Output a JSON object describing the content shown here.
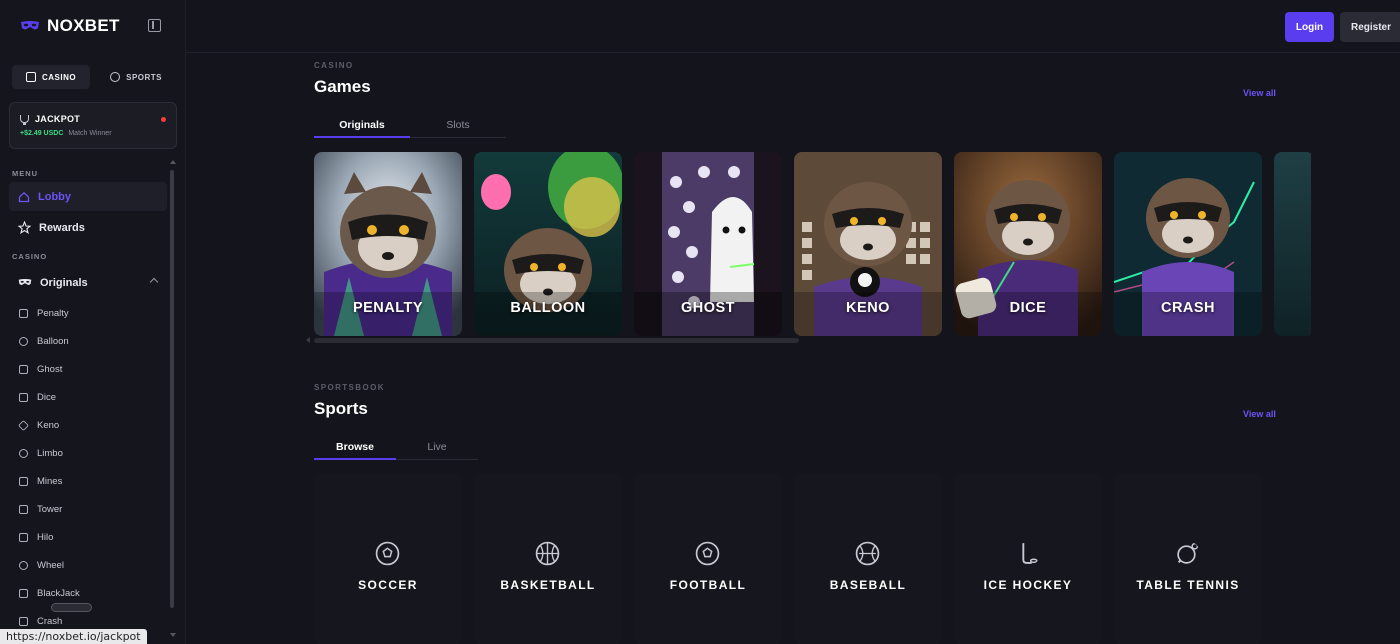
{
  "brand": {
    "name": "NOXBET"
  },
  "header": {
    "login_label": "Login",
    "register_label": "Register"
  },
  "sidebar": {
    "mode_tabs": [
      {
        "label": "CASINO"
      },
      {
        "label": "SPORTS"
      }
    ],
    "jackpot": {
      "title": "JACKPOT",
      "amount": "+$2.49 USDC",
      "subtitle": "Match Winner"
    },
    "menu_label": "MENU",
    "menu_items": [
      {
        "label": "Lobby"
      },
      {
        "label": "Rewards"
      }
    ],
    "casino_label": "CASINO",
    "originals_label": "Originals",
    "originals_items": [
      {
        "label": "Penalty"
      },
      {
        "label": "Balloon"
      },
      {
        "label": "Ghost"
      },
      {
        "label": "Dice"
      },
      {
        "label": "Keno"
      },
      {
        "label": "Limbo"
      },
      {
        "label": "Mines"
      },
      {
        "label": "Tower"
      },
      {
        "label": "Hilo"
      },
      {
        "label": "Wheel"
      },
      {
        "label": "BlackJack"
      },
      {
        "label": "Crash"
      }
    ]
  },
  "status_bar": {
    "url": "https://noxbet.io/jackpot"
  },
  "games_section": {
    "eyebrow": "CASINO",
    "title": "Games",
    "view_all": "View all",
    "tabs": [
      {
        "label": "Originals"
      },
      {
        "label": "Slots"
      }
    ],
    "cards": [
      {
        "title": "PENALTY"
      },
      {
        "title": "BALLOON"
      },
      {
        "title": "GHOST"
      },
      {
        "title": "KENO"
      },
      {
        "title": "DICE"
      },
      {
        "title": "CRASH"
      }
    ]
  },
  "sports_section": {
    "eyebrow": "SPORTSBOOK",
    "title": "Sports",
    "view_all": "View all",
    "tabs": [
      {
        "label": "Browse"
      },
      {
        "label": "Live"
      }
    ],
    "cards": [
      {
        "title": "SOCCER",
        "icon": "soccer-ball-icon"
      },
      {
        "title": "BASKETBALL",
        "icon": "basketball-icon"
      },
      {
        "title": "FOOTBALL",
        "icon": "football-icon"
      },
      {
        "title": "BASEBALL",
        "icon": "baseball-icon"
      },
      {
        "title": "ICE HOCKEY",
        "icon": "hockey-stick-icon"
      },
      {
        "title": "TABLE TENNIS",
        "icon": "table-tennis-icon"
      }
    ]
  },
  "colors": {
    "accent": "#5b3df0",
    "link": "#6b54f5",
    "positive": "#3ddc84",
    "alert": "#ff3b3b"
  }
}
